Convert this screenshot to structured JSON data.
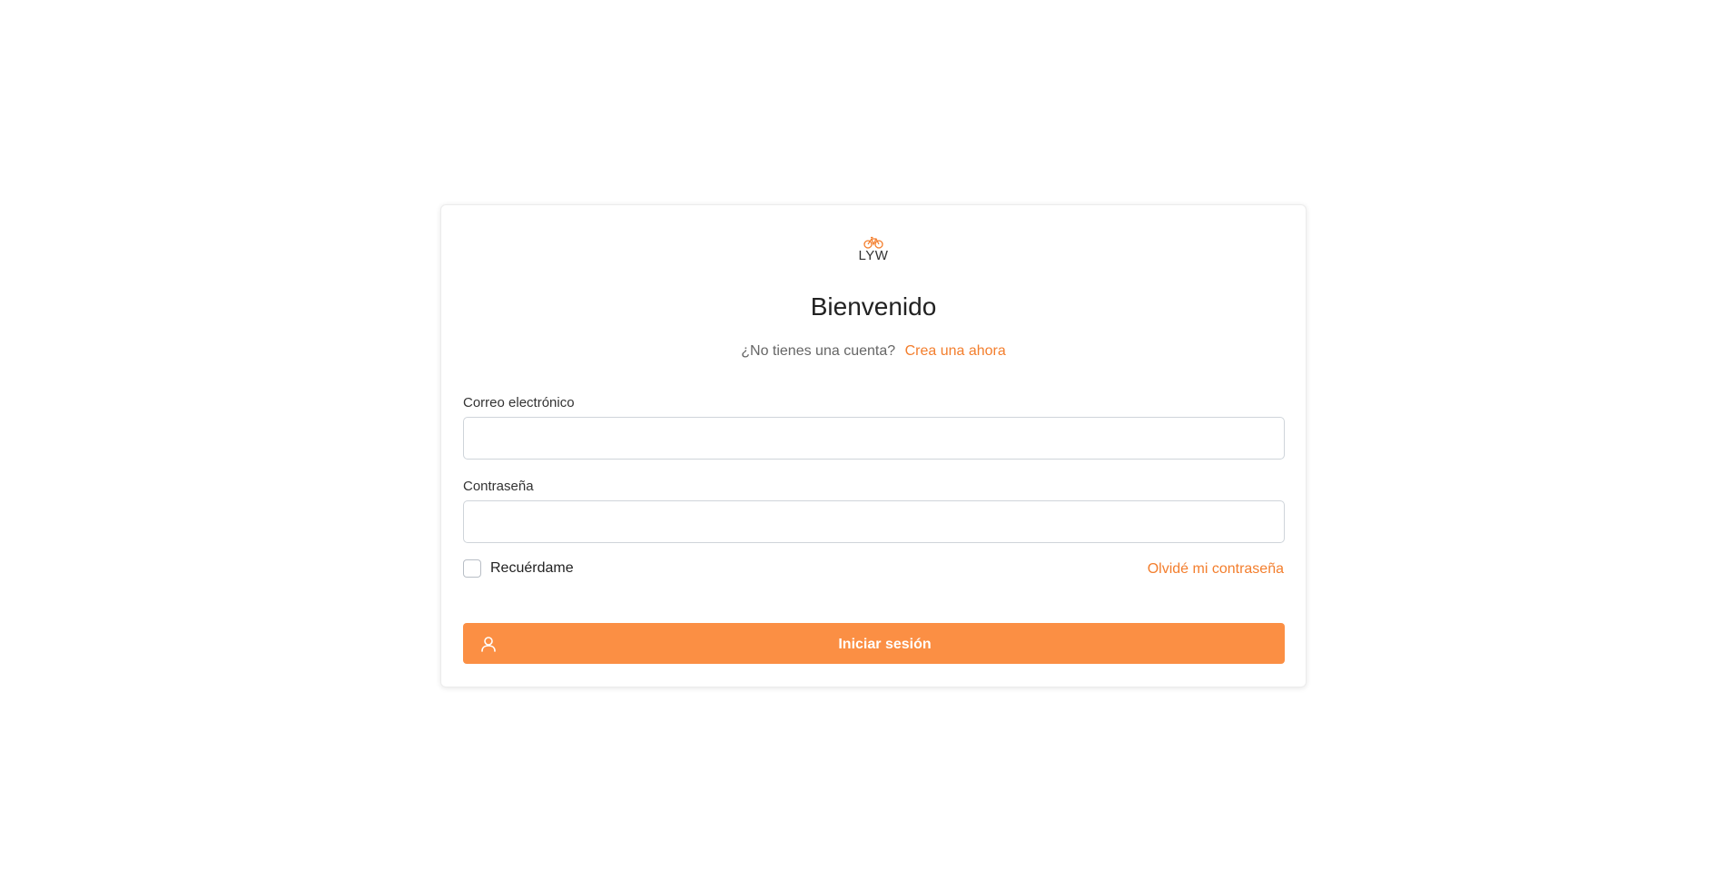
{
  "brand": {
    "logo_text": "LYW",
    "logo_icon": "bicycle-icon",
    "accent_color": "#f37e2d",
    "button_color": "#fb8f44"
  },
  "login": {
    "title": "Bienvenido",
    "no_account_text": "¿No tienes una cuenta?",
    "create_link": "Crea una ahora",
    "email_label": "Correo electrónico",
    "email_value": "",
    "password_label": "Contraseña",
    "password_value": "",
    "remember_label": "Recuérdame",
    "remember_checked": false,
    "forgot_link": "Olvidé mi contraseña",
    "submit_label": "Iniciar sesión",
    "submit_icon": "user-icon"
  }
}
